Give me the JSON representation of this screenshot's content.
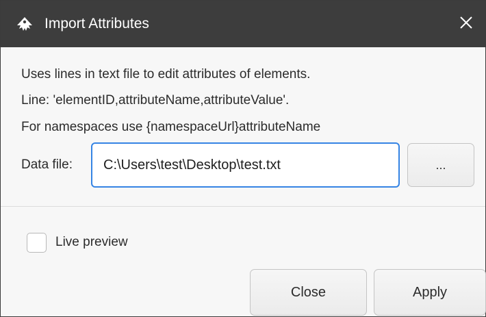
{
  "window": {
    "title": "Import Attributes",
    "icon": "inkscape-logo-icon",
    "close_icon": "close-icon"
  },
  "description": {
    "line1": "Uses lines in text file to edit attributes of elements.",
    "line2": "Line: 'elementID,attributeName,attributeValue'.",
    "line3": "For namespaces use {namespaceUrl}attributeName"
  },
  "data_file": {
    "label": "Data file:",
    "value": "C:\\Users\\test\\Desktop\\test.txt",
    "browse_label": "..."
  },
  "live_preview": {
    "label": "Live preview",
    "checked": false
  },
  "buttons": {
    "close_label": "Close",
    "apply_label": "Apply"
  },
  "colors": {
    "titlebar": "#3d3d3d",
    "focus_accent": "#3584e4",
    "background": "#f7f7f7"
  }
}
